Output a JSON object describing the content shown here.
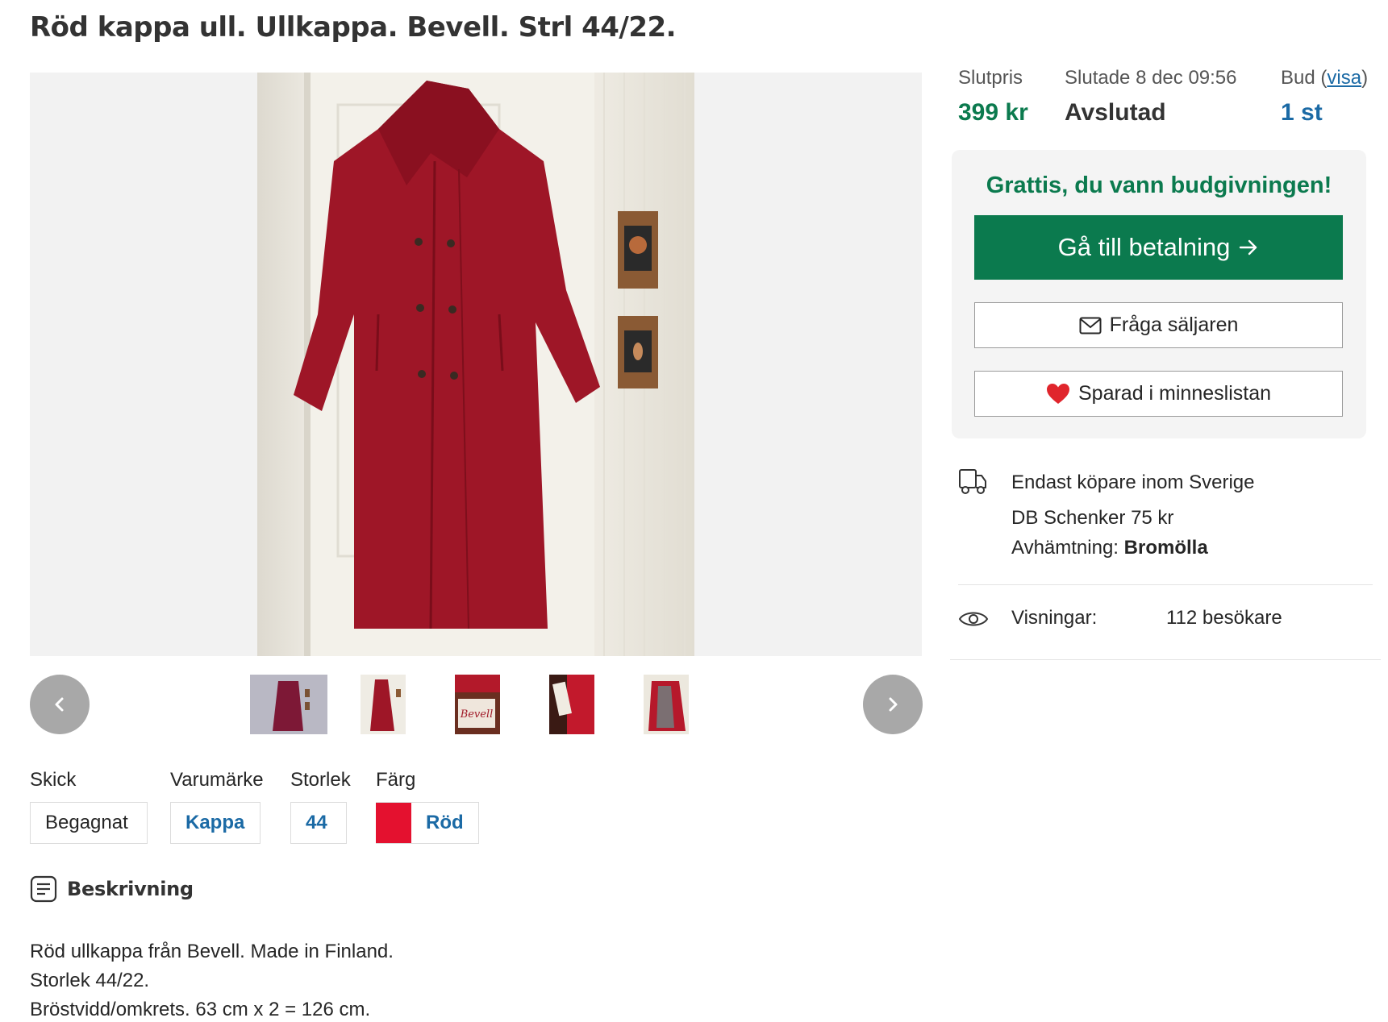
{
  "listing": {
    "title": "Röd kappa ull. Ullkappa. Bevell. Strl 44/22."
  },
  "gallery": {
    "prev_icon": "chevron-left-icon",
    "next_icon": "chevron-right-icon",
    "thumbnail_count": 5
  },
  "attributes": {
    "condition": {
      "label": "Skick",
      "value": "Begagnat"
    },
    "brand": {
      "label": "Varumärke",
      "value": "Kappa"
    },
    "size": {
      "label": "Storlek",
      "value": "44"
    },
    "color": {
      "label": "Färg",
      "value": "Röd",
      "swatch": "#e4112f"
    }
  },
  "description": {
    "heading": "Beskrivning",
    "icon": "document-icon",
    "lines": [
      "Röd ullkappa från Bevell. Made in Finland.",
      "Storlek 44/22.",
      "Bröstvidd/omkrets. 63 cm x 2 = 126 cm."
    ]
  },
  "auction": {
    "final_price_label": "Slutpris",
    "final_price": "399 kr",
    "ended_label": "Slutade 8 dec 09:56",
    "status": "Avslutad",
    "bids_label": "Bud",
    "bids_link": "visa",
    "bids_count": "1 st"
  },
  "winner_card": {
    "message": "Grattis, du vann budgivningen!",
    "pay_button": "Gå till betalning",
    "pay_icon": "arrow-right-icon",
    "ask_button": "Fråga säljaren",
    "ask_icon": "mail-icon",
    "save_button": "Sparad i minneslistan",
    "save_icon": "heart-icon"
  },
  "shipping": {
    "icon": "truck-icon",
    "restriction": "Endast köpare inom Sverige",
    "carrier": "DB Schenker 75 kr",
    "pickup_label": "Avhämtning:",
    "pickup_location": "Bromölla"
  },
  "views": {
    "icon": "eye-icon",
    "label": "Visningar:",
    "value": "112 besökare"
  },
  "colors": {
    "accent_green": "#0b7a4e",
    "link_blue": "#1b6aa5",
    "heart_red": "#e0252c"
  }
}
